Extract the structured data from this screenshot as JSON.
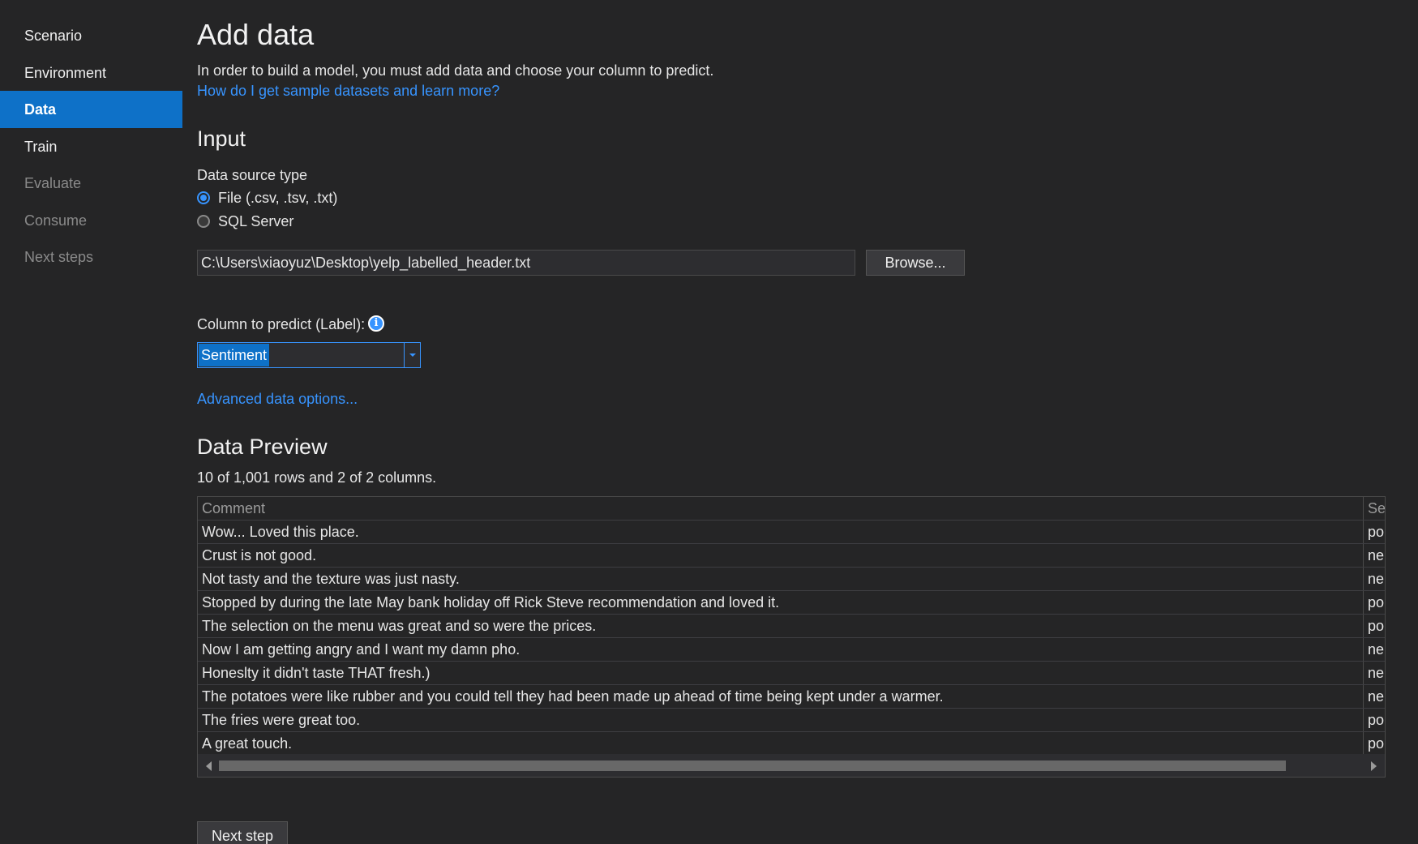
{
  "sidebar": {
    "items": [
      {
        "label": "Scenario",
        "state": "normal"
      },
      {
        "label": "Environment",
        "state": "normal"
      },
      {
        "label": "Data",
        "state": "active"
      },
      {
        "label": "Train",
        "state": "normal"
      },
      {
        "label": "Evaluate",
        "state": "disabled"
      },
      {
        "label": "Consume",
        "state": "disabled"
      },
      {
        "label": "Next steps",
        "state": "disabled"
      }
    ]
  },
  "main": {
    "title": "Add data",
    "intro": "In order to build a model, you must add data and choose your column to predict.",
    "help_link": "How do I get sample datasets and learn more?",
    "input_section": {
      "title": "Input",
      "source_type_label": "Data source type",
      "options": [
        {
          "label": "File (.csv, .tsv, .txt)",
          "checked": true
        },
        {
          "label": "SQL Server",
          "checked": false
        }
      ],
      "file_path": "C:\\Users\\xiaoyuz\\Desktop\\yelp_labelled_header.txt",
      "browse_label": "Browse...",
      "column_label": "Column to predict (Label):",
      "column_value": "Sentiment",
      "advanced_link": "Advanced data options..."
    },
    "preview": {
      "title": "Data Preview",
      "count_text": "10 of 1,001 rows and 2 of 2 columns.",
      "columns": [
        "Comment",
        "Se"
      ],
      "rows": [
        [
          "Wow... Loved this place.",
          "po"
        ],
        [
          "Crust is not good.",
          "ne"
        ],
        [
          "Not tasty and the texture was just nasty.",
          "ne"
        ],
        [
          "Stopped by during the late May bank holiday off Rick Steve recommendation and loved it.",
          "po"
        ],
        [
          "The selection on the menu was great and so were the prices.",
          "po"
        ],
        [
          "Now I am getting angry and I want my damn pho.",
          "ne"
        ],
        [
          "Honeslty it didn't taste THAT fresh.)",
          "ne"
        ],
        [
          "The potatoes were like rubber and you could tell they had been made up ahead of time being kept under a warmer.",
          "ne"
        ],
        [
          "The fries were great too.",
          "po"
        ],
        [
          "A great touch.",
          "po"
        ]
      ]
    },
    "next_step_label": "Next step"
  },
  "colors": {
    "background": "#252526",
    "accent": "#0e71c8",
    "link": "#3794ff"
  }
}
